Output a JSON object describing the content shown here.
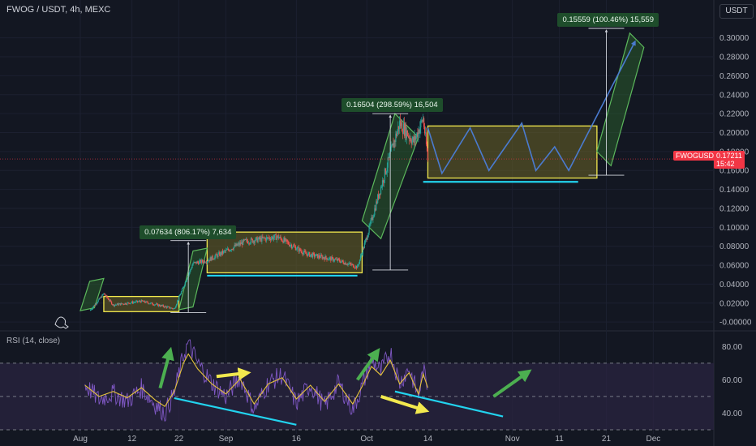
{
  "header": {
    "title": "FWOG / USDT, 4h, MEXC",
    "unit_button": "USDT"
  },
  "rsi_label": "RSI (14, close)",
  "price_tag": {
    "symbol": "FWOGUSDT",
    "price": "0.17211",
    "countdown": "15:42"
  },
  "callouts": [
    {
      "text": "0.07634 (806.17%) 7,634"
    },
    {
      "text": "0.16504 (298.59%) 16,504"
    },
    {
      "text": "0.15559 (100.46%) 15,559"
    }
  ],
  "colors": {
    "background": "#131722",
    "up": "#26a69a",
    "down": "#ef5350",
    "range_box": "#f2e94e",
    "channel": "#5cb85c",
    "support": "#22d3ee",
    "projection": "#4a7bd0",
    "rsi_line": "#7e57c2",
    "rsi_ma": "#e5c33a",
    "arrow_green": "#4caf50",
    "arrow_yellow": "#f2e94e",
    "rsi_band": "#2a2440"
  },
  "chart_data": [
    {
      "type": "candlestick",
      "title": "FWOG / USDT, 4h, MEXC",
      "ylim": [
        -0.005,
        0.31
      ],
      "y_ticks": [
        "0.30000",
        "0.28000",
        "0.26000",
        "0.24000",
        "0.22000",
        "0.20000",
        "0.18000",
        "0.16000",
        "0.14000",
        "0.12000",
        "0.10000",
        "0.08000",
        "0.06000",
        "0.04000",
        "0.02000",
        "-0.00000"
      ],
      "x_tick_labels": [
        "Aug",
        "12",
        "22",
        "Sep",
        "16",
        "Oct",
        "14",
        "Nov",
        "11",
        "21",
        "Dec"
      ],
      "last_price": 0.17211,
      "price_path": [
        {
          "date": "2024-08-03",
          "price": 0.012
        },
        {
          "date": "2024-08-06",
          "price": 0.03
        },
        {
          "date": "2024-08-08",
          "price": 0.018
        },
        {
          "date": "2024-08-14",
          "price": 0.022
        },
        {
          "date": "2024-08-21",
          "price": 0.014
        },
        {
          "date": "2024-08-25",
          "price": 0.062
        },
        {
          "date": "2024-08-28",
          "price": 0.065
        },
        {
          "date": "2024-09-05",
          "price": 0.085
        },
        {
          "date": "2024-09-12",
          "price": 0.09
        },
        {
          "date": "2024-09-18",
          "price": 0.072
        },
        {
          "date": "2024-09-25",
          "price": 0.065
        },
        {
          "date": "2024-09-29",
          "price": 0.058
        },
        {
          "date": "2024-10-01",
          "price": 0.09
        },
        {
          "date": "2024-10-05",
          "price": 0.16
        },
        {
          "date": "2024-10-08",
          "price": 0.21
        },
        {
          "date": "2024-10-11",
          "price": 0.19
        },
        {
          "date": "2024-10-13",
          "price": 0.215
        },
        {
          "date": "2024-10-14",
          "price": 0.172
        }
      ],
      "annotations": {
        "range_boxes": [
          {
            "x0": "2024-08-06",
            "x1": "2024-08-22",
            "y0": 0.011,
            "y1": 0.027
          },
          {
            "x0": "2024-08-28",
            "x1": "2024-09-30",
            "y0": 0.052,
            "y1": 0.095
          },
          {
            "x0": "2024-10-14",
            "x1": "2024-11-19",
            "y0": 0.152,
            "y1": 0.207
          }
        ],
        "channels": [
          [
            [
              "2024-08-01",
              0.012
            ],
            [
              "2024-08-04",
              0.015
            ],
            [
              "2024-08-06",
              0.046
            ],
            [
              "2024-08-03",
              0.043
            ]
          ],
          [
            [
              "2024-08-22",
              0.013
            ],
            [
              "2024-08-25",
              0.016
            ],
            [
              "2024-08-28",
              0.078
            ],
            [
              "2024-08-25",
              0.075
            ]
          ],
          [
            [
              "2024-09-30",
              0.107
            ],
            [
              "2024-10-04",
              0.088
            ],
            [
              "2024-10-12",
              0.195
            ],
            [
              "2024-10-07",
              0.22
            ]
          ],
          [
            [
              "2024-11-19",
              0.18
            ],
            [
              "2024-11-22",
              0.165
            ],
            [
              "2024-11-29",
              0.29
            ],
            [
              "2024-11-26",
              0.305
            ]
          ]
        ],
        "supports": [
          {
            "x0": "2024-08-28",
            "x1": "2024-09-29",
            "y": 0.049
          },
          {
            "x0": "2024-10-13",
            "x1": "2024-11-15",
            "y": 0.148
          }
        ],
        "projection": [
          [
            "2024-10-14",
            0.205
          ],
          [
            "2024-10-17",
            0.157
          ],
          [
            "2024-10-23",
            0.205
          ],
          [
            "2024-10-27",
            0.16
          ],
          [
            "2024-11-03",
            0.21
          ],
          [
            "2024-11-06",
            0.16
          ],
          [
            "2024-11-10",
            0.185
          ],
          [
            "2024-11-13",
            0.16
          ],
          [
            "2024-11-27",
            0.295
          ]
        ],
        "measures": [
          {
            "x": "2024-08-24",
            "y0": 0.01,
            "y1": 0.086,
            "callout": 0
          },
          {
            "x": "2024-10-06",
            "y0": 0.055,
            "y1": 0.22,
            "callout": 1
          },
          {
            "x": "2024-11-21",
            "y0": 0.155,
            "y1": 0.31,
            "callout": 2
          }
        ]
      }
    },
    {
      "type": "line",
      "title": "RSI (14, close)",
      "ylim": [
        30,
        85
      ],
      "y_ticks": [
        "80.00",
        "60.00",
        "40.00"
      ],
      "bands": [
        70,
        50,
        30
      ],
      "series": [
        {
          "values": [
            {
              "date": "2024-08-02",
              "value": 57
            },
            {
              "date": "2024-08-05",
              "value": 48
            },
            {
              "date": "2024-08-08",
              "value": 52
            },
            {
              "date": "2024-08-11",
              "value": 47
            },
            {
              "date": "2024-08-14",
              "value": 55
            },
            {
              "date": "2024-08-17",
              "value": 45
            },
            {
              "date": "2024-08-19",
              "value": 40
            },
            {
              "date": "2024-08-21",
              "value": 52
            },
            {
              "date": "2024-08-23",
              "value": 75
            },
            {
              "date": "2024-08-24",
              "value": 82
            },
            {
              "date": "2024-08-26",
              "value": 70
            },
            {
              "date": "2024-08-29",
              "value": 58
            },
            {
              "date": "2024-09-01",
              "value": 50
            },
            {
              "date": "2024-09-04",
              "value": 62
            },
            {
              "date": "2024-09-07",
              "value": 42
            },
            {
              "date": "2024-09-10",
              "value": 58
            },
            {
              "date": "2024-09-13",
              "value": 63
            },
            {
              "date": "2024-09-16",
              "value": 46
            },
            {
              "date": "2024-09-19",
              "value": 57
            },
            {
              "date": "2024-09-22",
              "value": 44
            },
            {
              "date": "2024-09-25",
              "value": 58
            },
            {
              "date": "2024-09-28",
              "value": 42
            },
            {
              "date": "2024-09-30",
              "value": 56
            },
            {
              "date": "2024-10-02",
              "value": 72
            },
            {
              "date": "2024-10-04",
              "value": 65
            },
            {
              "date": "2024-10-06",
              "value": 77
            },
            {
              "date": "2024-10-08",
              "value": 58
            },
            {
              "date": "2024-10-10",
              "value": 67
            },
            {
              "date": "2024-10-12",
              "value": 50
            },
            {
              "date": "2024-10-13",
              "value": 66
            },
            {
              "date": "2024-10-14",
              "value": 55
            }
          ]
        }
      ],
      "annotations": {
        "trendlines": [
          [
            [
              "2024-08-21",
              49
            ],
            [
              "2024-09-16",
              33
            ]
          ],
          [
            [
              "2024-10-07",
              53
            ],
            [
              "2024-10-30",
              38
            ]
          ]
        ],
        "arrows": [
          {
            "color": "green",
            "from": [
              "2024-08-18",
              55
            ],
            "to": [
              "2024-08-20",
              76
            ]
          },
          {
            "color": "yellow",
            "from": [
              "2024-08-30",
              62
            ],
            "to": [
              "2024-09-05",
              64
            ]
          },
          {
            "color": "green",
            "from": [
              "2024-09-29",
              60
            ],
            "to": [
              "2024-10-03",
              76
            ]
          },
          {
            "color": "yellow",
            "from": [
              "2024-10-04",
              50
            ],
            "to": [
              "2024-10-13",
              42
            ]
          },
          {
            "color": "green",
            "from": [
              "2024-10-28",
              50
            ],
            "to": [
              "2024-11-04",
              64
            ]
          }
        ]
      }
    }
  ]
}
